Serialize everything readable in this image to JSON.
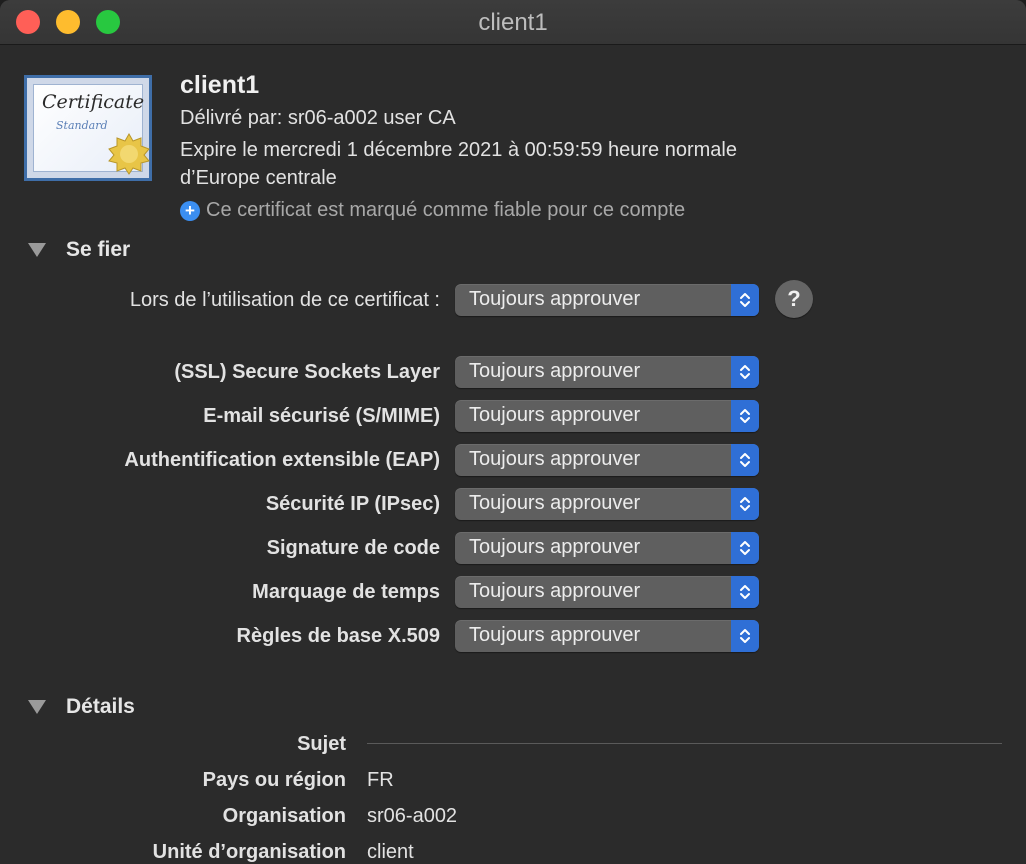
{
  "window": {
    "title": "client1"
  },
  "certificate": {
    "icon_script": "Certificate",
    "icon_sub": "Standard",
    "name": "client1",
    "issued_by": "Délivré par: sr06-a002 user CA",
    "expires_line1": "Expire le mercredi 1 décembre 2021 à 00:59:59 heure normale",
    "expires_line2": "d’Europe centrale",
    "trust_status": "Ce certificat est marqué comme fiable pour ce compte"
  },
  "trust": {
    "section_label": "Se fier",
    "when_using_label": "Lors de l’utilisation de ce certificat :",
    "when_using_value": "Toujours approuver",
    "help_label": "?",
    "rows": [
      {
        "label": "(SSL) Secure Sockets Layer",
        "value": "Toujours approuver"
      },
      {
        "label": "E-mail sécurisé (S/MIME)",
        "value": "Toujours approuver"
      },
      {
        "label": "Authentification extensible (EAP)",
        "value": "Toujours approuver"
      },
      {
        "label": "Sécurité IP (IPsec)",
        "value": "Toujours approuver"
      },
      {
        "label": "Signature de code",
        "value": "Toujours approuver"
      },
      {
        "label": "Marquage de temps",
        "value": "Toujours approuver"
      },
      {
        "label": "Règles de base X.509",
        "value": "Toujours approuver"
      }
    ]
  },
  "details": {
    "section_label": "Détails",
    "subject_label": "Sujet",
    "fields": [
      {
        "label": "Pays ou région",
        "value": "FR"
      },
      {
        "label": "Organisation",
        "value": "sr06-a002"
      },
      {
        "label": "Unité d’organisation",
        "value": "client"
      }
    ]
  },
  "colors": {
    "accent": "#2f6fd6",
    "background": "#2b2b2b",
    "popup": "#5f5f5f"
  }
}
